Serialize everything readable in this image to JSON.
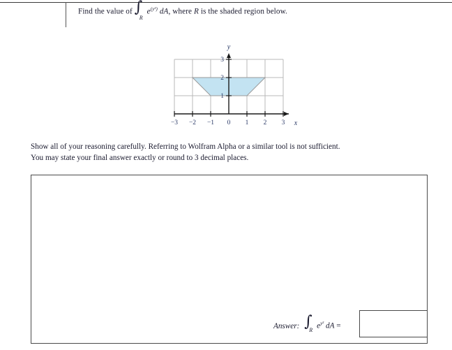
{
  "prompt": {
    "before_integral": "Find the value of",
    "integrand": "e",
    "integrand_exponent": "(y²)",
    "differential": "dA,",
    "after_integral": "where",
    "region_symbol": "R",
    "tail": "is the shaded region below.",
    "integral_subscript": "R",
    "integral_symbol": "∫"
  },
  "instructions": {
    "line1": "Show all of your reasoning carefully.  Referring to Wolfram Alpha or a similar tool is not sufficient.",
    "line2": "You may state your final answer exactly or round to 3 decimal places."
  },
  "answer": {
    "label": "Answer:",
    "integral_symbol": "∫",
    "integral_subscript": "R",
    "integrand": "e",
    "integrand_exponent": "y²",
    "differential": "dA",
    "equals": "=",
    "value": ""
  },
  "workbox": {
    "content": ""
  },
  "colors": {
    "shade_fill": "#c3e3f2",
    "shade_stroke": "#9a9a9a",
    "grid_line": "#b8b8b8",
    "axis_line": "#1a1a1a",
    "box_border": "#4a4a4a",
    "text": "#1a1a2e",
    "tick_label": "#2b3a67"
  },
  "chart_data": {
    "type": "area",
    "title": "",
    "xlabel": "x",
    "ylabel": "y",
    "xlim": [
      -3,
      3
    ],
    "ylim": [
      0,
      3
    ],
    "xticks": [
      -3,
      -2,
      -1,
      0,
      1,
      2,
      3
    ],
    "xtick_labels": [
      "−3",
      "−2",
      "−1",
      "0",
      "1",
      "2",
      "3"
    ],
    "yticks": [
      1,
      2,
      3
    ],
    "ytick_labels": [
      "1",
      "2",
      "3"
    ],
    "grid": true,
    "grid_spacing": 1,
    "legend": null,
    "shaded_region": {
      "name": "R",
      "shape": "trapezoid",
      "vertices": [
        [
          -2,
          2
        ],
        [
          2,
          2
        ],
        [
          1,
          1
        ],
        [
          -1,
          1
        ]
      ],
      "fill": "#c3e3f2",
      "description": "Trapezoid bounded above by y=2 from x=-2 to x=2, below by y=1 from x=-1 to x=1, with slanted sides from (-2,2) to (-1,1) and (2,2) to (1,1)."
    }
  }
}
